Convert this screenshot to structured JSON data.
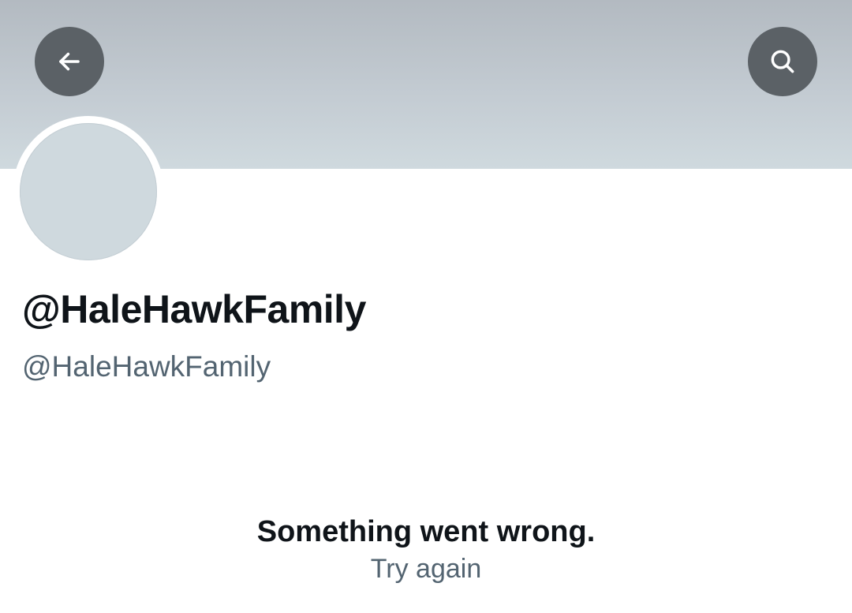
{
  "header": {
    "back_icon": "arrow-left-icon",
    "search_icon": "search-icon",
    "banner_color": "#c3cbd2",
    "button_color": "#5b6166"
  },
  "profile": {
    "display_name": "@HaleHawkFamily",
    "handle": "@HaleHawkFamily",
    "avatar_color": "#cfd9de"
  },
  "error": {
    "message": "Something went wrong.",
    "retry_label": "Try again"
  }
}
